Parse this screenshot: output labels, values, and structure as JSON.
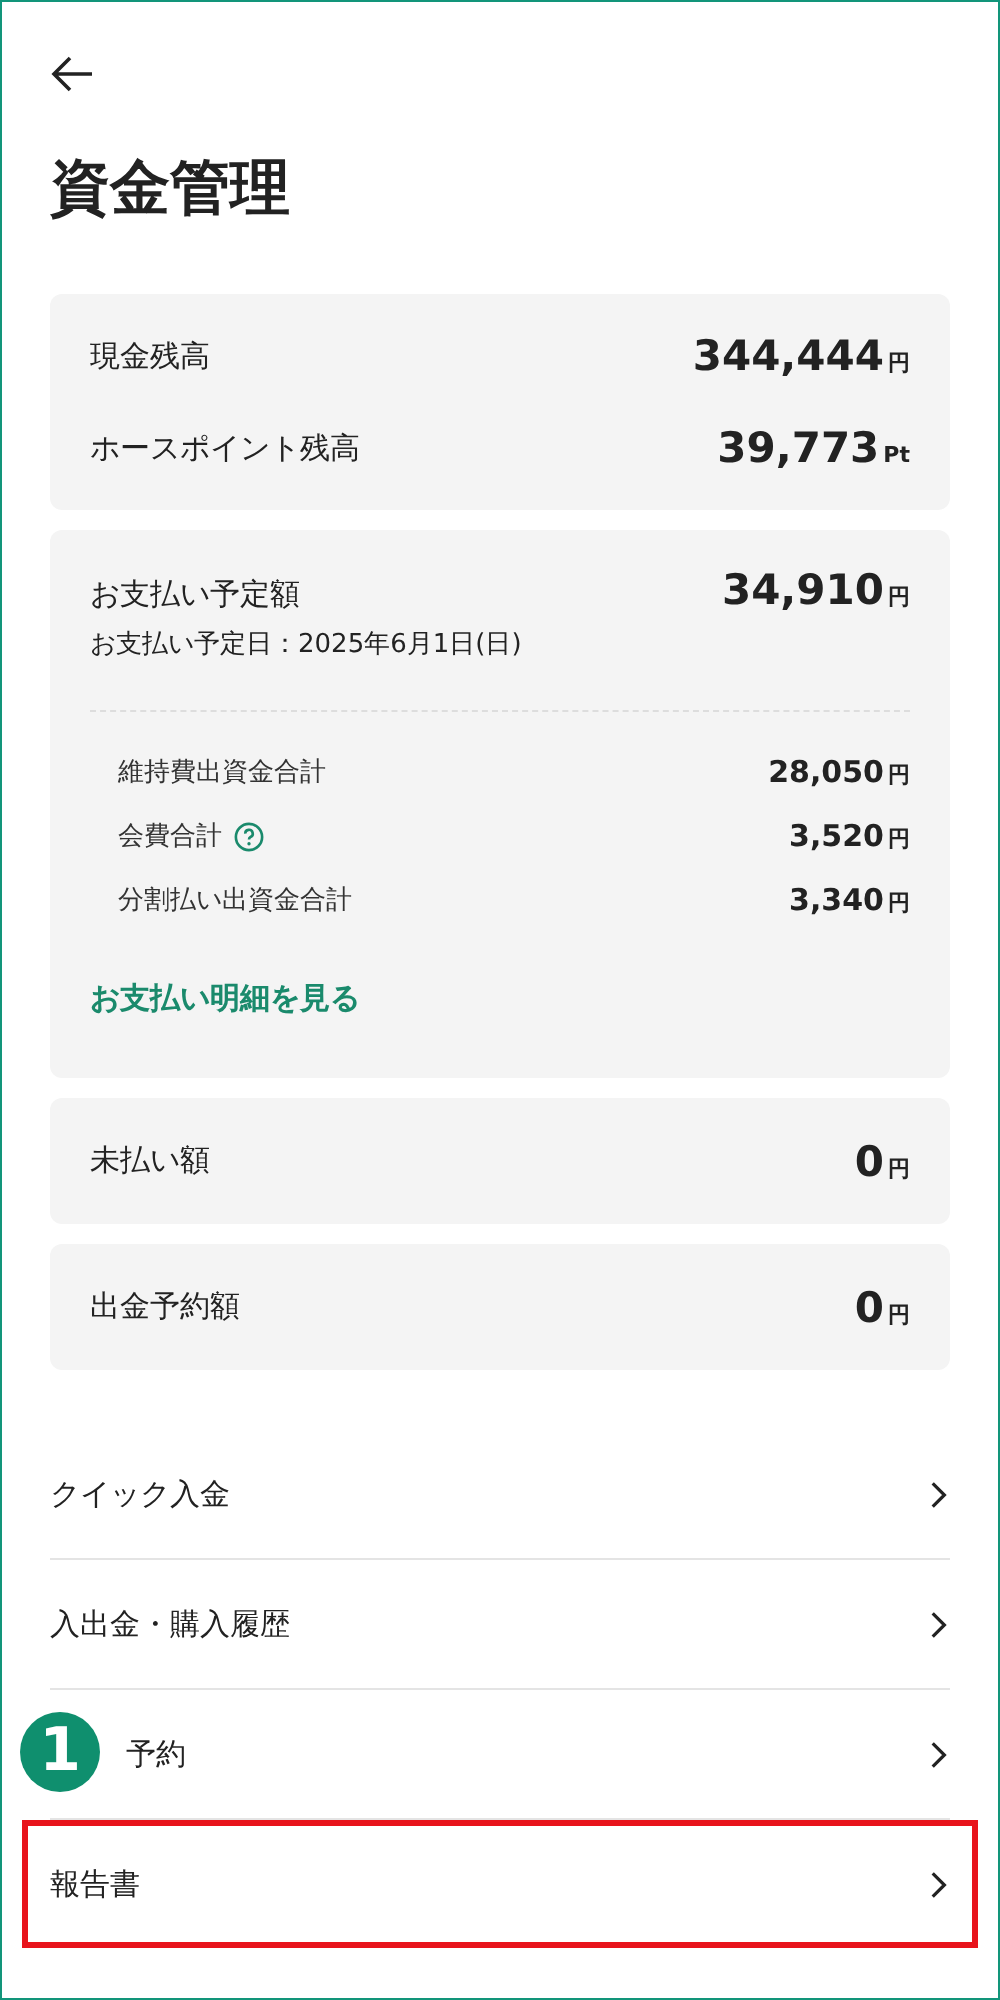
{
  "title": "資金管理",
  "balances": [
    {
      "label": "現金残高",
      "value": "344,444",
      "unit": "円"
    },
    {
      "label": "ホースポイント残高",
      "value": "39,773",
      "unit": "Pt"
    }
  ],
  "payment": {
    "label": "お支払い予定額",
    "value": "34,910",
    "unit": "円",
    "date": "お支払い予定日：2025年6月1日(日)",
    "breakdown": [
      {
        "label": "維持費出資金合計",
        "value": "28,050",
        "unit": "円",
        "help": false
      },
      {
        "label": "会費合計",
        "value": "3,520",
        "unit": "円",
        "help": true
      },
      {
        "label": "分割払い出資金合計",
        "value": "3,340",
        "unit": "円",
        "help": false
      }
    ],
    "link": "お支払い明細を見る"
  },
  "summaries": [
    {
      "label": "未払い額",
      "value": "0",
      "unit": "円"
    },
    {
      "label": "出金予約額",
      "value": "0",
      "unit": "円"
    }
  ],
  "menu": [
    {
      "label": "クイック入金",
      "highlighted": false
    },
    {
      "label": "入出金・購入履歴",
      "highlighted": false
    },
    {
      "label": "予約",
      "highlighted": false,
      "callout": "1"
    },
    {
      "label": "報告書",
      "highlighted": true
    }
  ]
}
